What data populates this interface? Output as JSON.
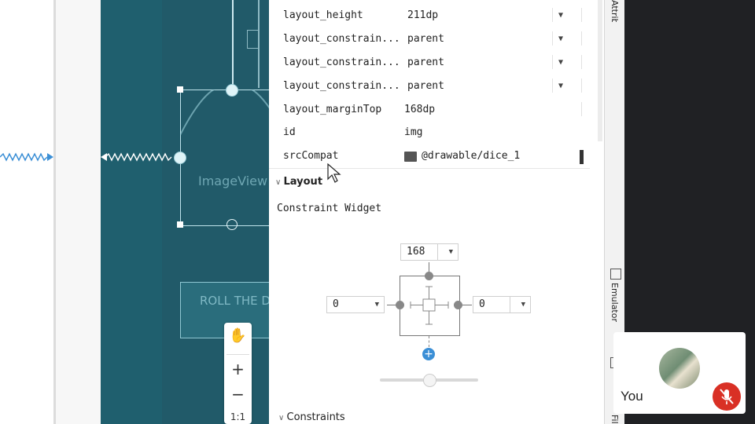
{
  "properties": [
    {
      "key": "layout_height",
      "value": "211dp",
      "dropdown": true
    },
    {
      "key": "layout_constrain...",
      "value": "parent",
      "dropdown": true
    },
    {
      "key": "layout_constrain...",
      "value": "parent",
      "dropdown": true
    },
    {
      "key": "layout_constrain...",
      "value": "parent",
      "dropdown": true
    },
    {
      "key": "layout_marginTop",
      "value": "168dp",
      "dropdown": false
    },
    {
      "key": "id",
      "value": "img",
      "dropdown": false
    },
    {
      "key": "srcCompat",
      "value": "@drawable/dice_1",
      "dropdown": false
    }
  ],
  "sections": {
    "layout": "Layout",
    "constraint_widget": "Constraint Widget",
    "constraints": "Constraints"
  },
  "constraint_widget": {
    "top": "168",
    "left": "0",
    "right": "0"
  },
  "design": {
    "image_label": "ImageView",
    "button_label": "ROLL THE DICE"
  },
  "side_tabs": {
    "top": "Attributes",
    "emulator": "Emulator",
    "bottom": "Files"
  },
  "zoom": {
    "zoom_in": "+",
    "zoom_out": "−",
    "actual_size": "1:1"
  },
  "meeting": {
    "self_label": "You",
    "colors": {
      "mute_bg": "#d93025"
    }
  },
  "colors": {
    "design_bg": "#1f5f6e",
    "blueprint_line": "#bfe4ec",
    "arrow": "#2f8fd8"
  }
}
